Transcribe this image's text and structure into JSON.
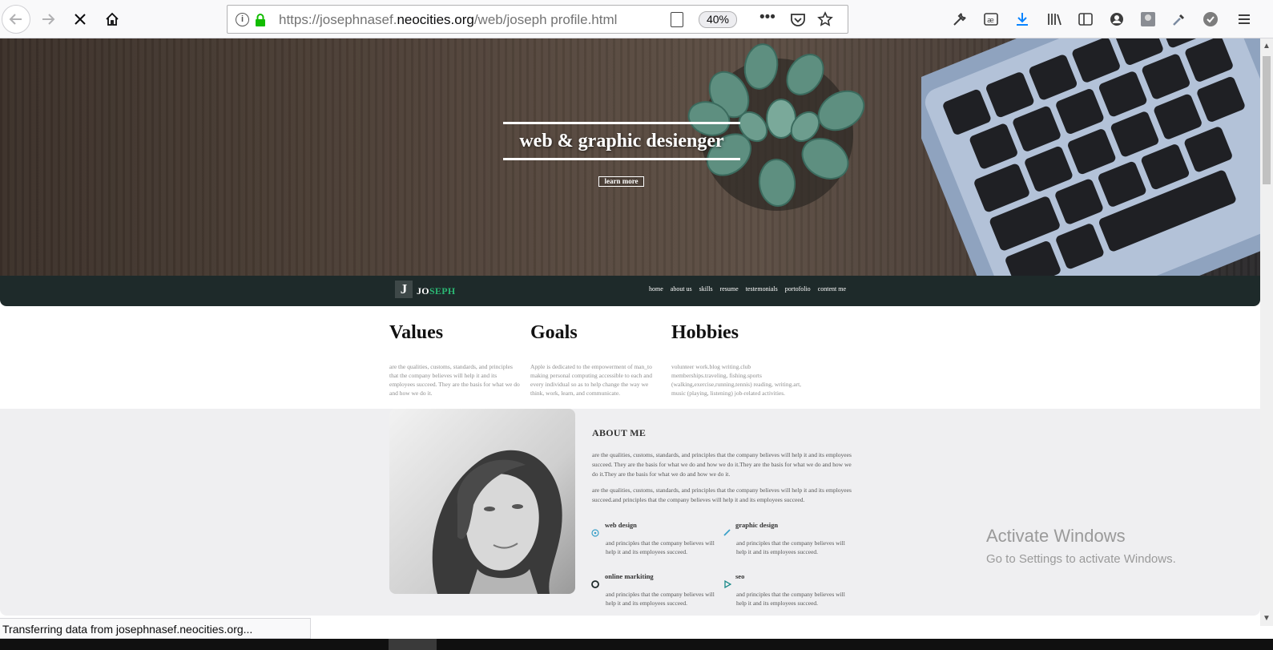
{
  "browser": {
    "url_prefix": "https://josephnasef.",
    "url_domain": "neocities.org",
    "url_path": "/web/joseph profile.html",
    "zoom": "40%",
    "status": "Transferring data from josephnasef.neocities.org..."
  },
  "hero": {
    "title": "web & graphic desienger",
    "button": "learn more"
  },
  "nav": {
    "logo_letter": "J",
    "logo_jo": "JO",
    "logo_seph": "SEPH",
    "links": [
      "home",
      "about us",
      "skills",
      "resume",
      "testemonials",
      "portofolio",
      "content me"
    ]
  },
  "columns": [
    {
      "title": "Values",
      "text": "are the qualities, customs, standards, and principles that the company believes will help it and its employees succeed. They are the basis for what we do and how we do it."
    },
    {
      "title": "Goals",
      "text": "Apple is dedicated to the empowerment of man_to making personal computing accessible to each and every individual so as to help change the way we think, work, learn, and communicate."
    },
    {
      "title": "Hobbies",
      "text": "volunteer work.blog writing.club memberships.traveling, fishing.sports (walking,exercise,running,tennis) reading, writing.art, music (playing, listening) job-related activities."
    }
  ],
  "about": {
    "title": "ABOUT ME",
    "para1": "are the qualities, customs, standards, and principles that the company believes will help it and its employees succeed. They are the basis for what we do and how we do it.They are the basis for what we do and how we do it.They are the basis for what we do and how we do it.",
    "para2": "are the qualities, customs, standards, and principles that the company believes will help it and its employees succeed.and principles that the company believes will help it and its employees succeed.",
    "services": [
      {
        "title": "web design",
        "text": "and principles that the company believes will help it and its employees succeed.",
        "icon": "compass-icon",
        "color": "#3aa0c8"
      },
      {
        "title": "graphic design",
        "text": "and principles that the company believes will help it and its employees succeed.",
        "icon": "pencil-icon",
        "color": "#3aa0c8"
      },
      {
        "title": "online markiting",
        "text": "and principles that the company believes will help it and its employees succeed.",
        "icon": "circle-icon",
        "color": "#1e2a2a"
      },
      {
        "title": "seo",
        "text": "and principles that the company believes will help it and its employees succeed.",
        "icon": "play-icon",
        "color": "#1b8a8a"
      }
    ]
  },
  "windows": {
    "activate_title": "Activate Windows",
    "activate_sub": "Go to Settings to activate Windows."
  },
  "colors": {
    "navbar": "#1e2a2a",
    "accent_green": "#2bb673",
    "section_bg": "#efeff1"
  }
}
